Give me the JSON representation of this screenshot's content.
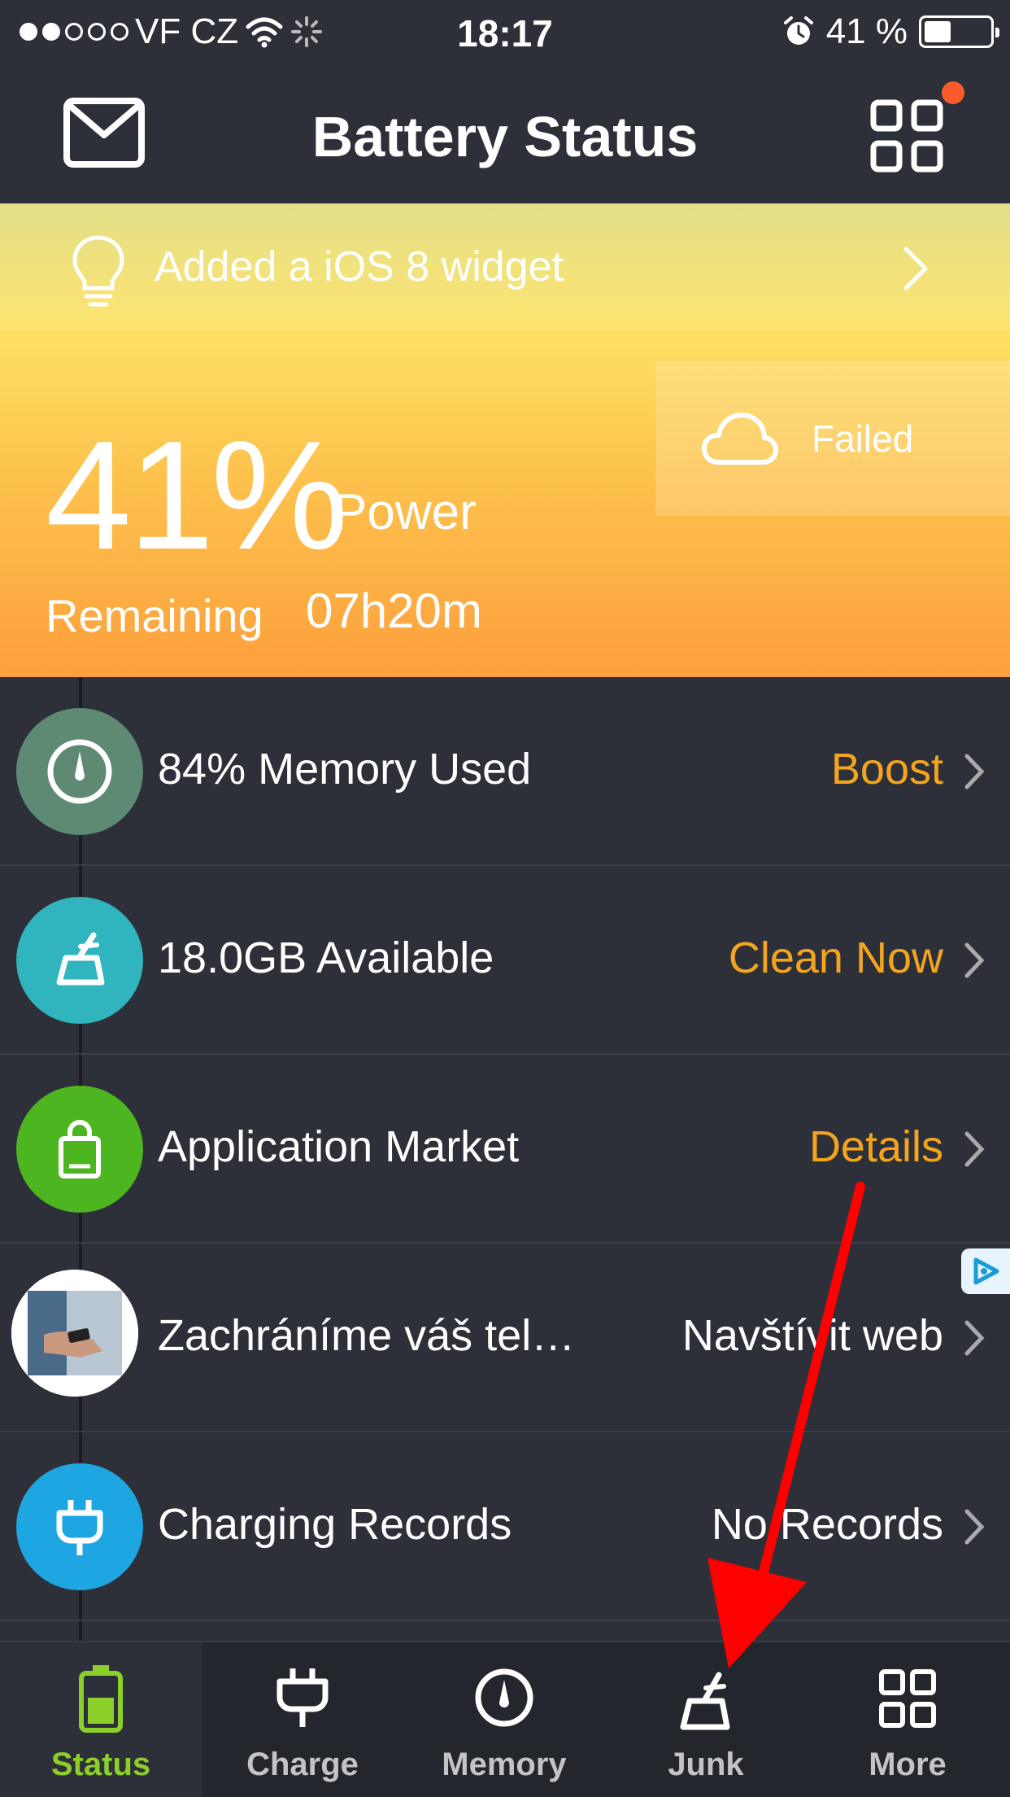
{
  "status_bar": {
    "carrier": "VF CZ",
    "time": "18:17",
    "battery_pct": "41 %",
    "battery_level": 0.41
  },
  "nav": {
    "title": "Battery Status"
  },
  "widget_banner": {
    "text": "Added a iOS 8 widget"
  },
  "weather": {
    "status": "Failed"
  },
  "battery": {
    "percent": "41%",
    "percent_label": "Power",
    "remaining_label": "Remaining",
    "remaining_value": "07h20m"
  },
  "rows": [
    {
      "title": "84% Memory Used",
      "action": "Boost",
      "icon": "gauge-icon",
      "color": "#5e8a73"
    },
    {
      "title": "18.0GB Available",
      "action": "Clean Now",
      "icon": "broom-icon",
      "color": "#30b4bd"
    },
    {
      "title": "Application Market",
      "action": "Details",
      "icon": "shopping-bag-icon",
      "color": "#4db51f"
    },
    {
      "title": "Zachráníme váš tel…",
      "action": "Navštívit web",
      "icon": "phone-photo-thumbnail"
    },
    {
      "title": "Charging Records",
      "action": "No Records",
      "icon": "plug-icon",
      "color": "#1ea6e2"
    }
  ],
  "tabs": [
    {
      "label": "Status",
      "icon": "battery-icon",
      "active": true
    },
    {
      "label": "Charge",
      "icon": "plug-icon"
    },
    {
      "label": "Memory",
      "icon": "gauge-icon"
    },
    {
      "label": "Junk",
      "icon": "broom-icon"
    },
    {
      "label": "More",
      "icon": "grid-icon"
    }
  ],
  "colors": {
    "accent_orange": "#f4a51f",
    "active_tab_green": "#8ccf2a",
    "annotation_arrow": "#ff0000",
    "notification_dot": "#fb5a2a"
  }
}
